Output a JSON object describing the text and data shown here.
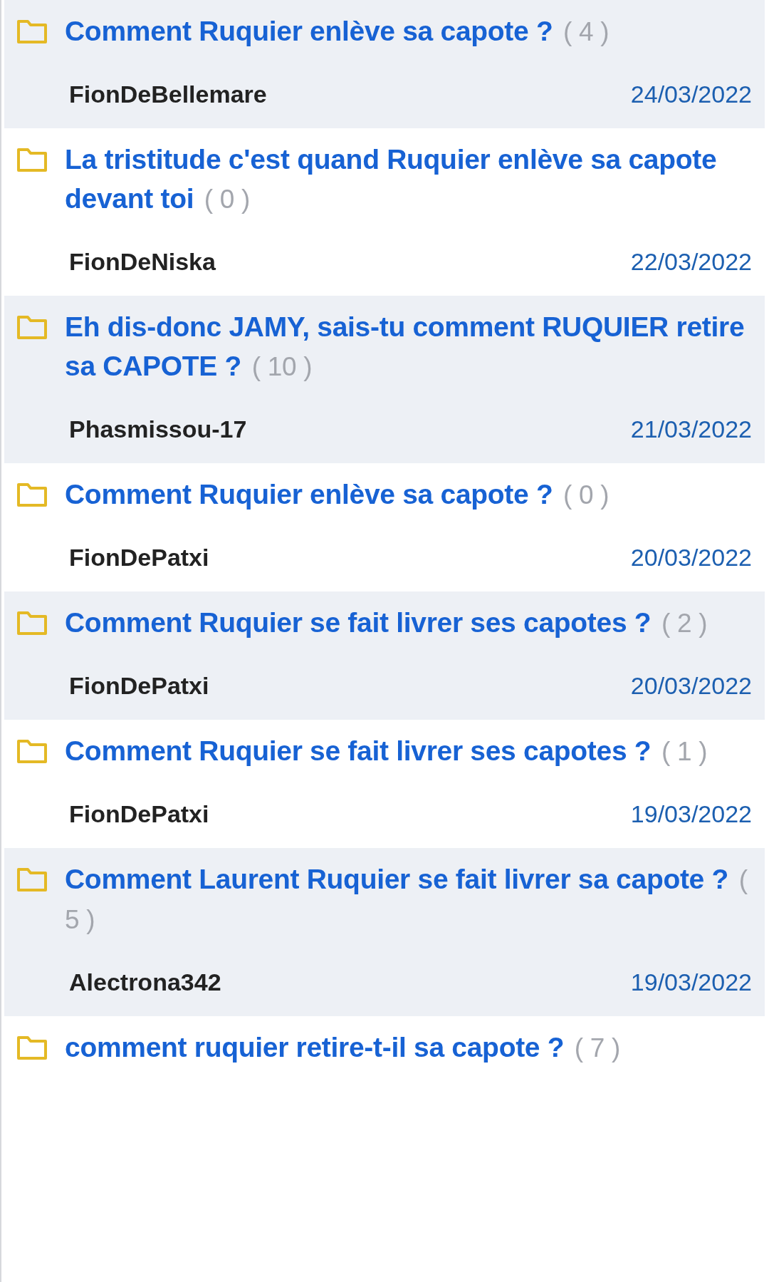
{
  "topics": [
    {
      "title": "Comment Ruquier enlève sa capote ?",
      "count": "( 4 )",
      "author": "FionDeBellemare",
      "date": "24/03/2022"
    },
    {
      "title": "La tristitude c'est quand Ruquier enlève sa capote devant toi",
      "count": "( 0 )",
      "author": "FionDeNiska",
      "date": "22/03/2022"
    },
    {
      "title": "Eh dis-donc JAMY, sais-tu comment RUQUIER retire sa CAPOTE ?",
      "count": "( 10 )",
      "author": "Phasmissou-17",
      "date": "21/03/2022"
    },
    {
      "title": "Comment Ruquier enlève sa capote ?",
      "count": "( 0 )",
      "author": "FionDePatxi",
      "date": "20/03/2022"
    },
    {
      "title": "Comment Ruquier se fait livrer ses capotes ?",
      "count": "( 2 )",
      "author": "FionDePatxi",
      "date": "20/03/2022"
    },
    {
      "title": "Comment Ruquier se fait livrer ses capotes ?",
      "count": "( 1 )",
      "author": "FionDePatxi",
      "date": "19/03/2022"
    },
    {
      "title": "Comment Laurent Ruquier se fait livrer sa capote ?",
      "count": "( 5 )",
      "author": "Alectrona342",
      "date": "19/03/2022"
    },
    {
      "title": "comment ruquier retire-t-il sa capote ?",
      "count": "( 7 )"
    }
  ]
}
